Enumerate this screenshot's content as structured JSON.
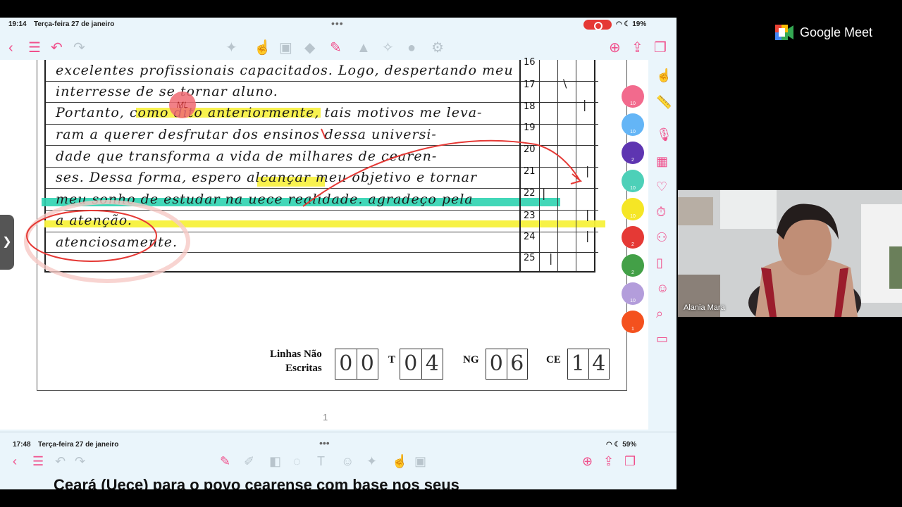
{
  "statusbar": {
    "time": "19:14",
    "date": "Terça-feira 27 de janeiro",
    "battery": "19%"
  },
  "statusbar2": {
    "time": "17:48",
    "date": "Terça-feira 27 de janeiro",
    "battery": "59%"
  },
  "handwriting": [
    "excelentes profissionais capacitados. Logo, despertando meu",
    "interresse de se tornar aluno.",
    "Portanto, como dito anteriormente, tais motivos me leva-",
    "ram a querer desfrutar dos ensinos dessa universi-",
    "dade que transforma a vida de milhares de cearen-",
    "ses. Dessa forma, espero alcançar meu objetivo e tornar",
    "meu sonho de estudar na uece realidade. agradeço pela",
    "a atenção.",
    "atenciosamente."
  ],
  "line_numbers": [
    "16",
    "17",
    "18",
    "19",
    "20",
    "21",
    "22",
    "23",
    "24",
    "25"
  ],
  "correction_mark": "ML",
  "score_labels": {
    "linhas1": "Linhas Não",
    "linhas2": "Escritas",
    "t": "T",
    "ng": "NG",
    "ce": "CE"
  },
  "score_values": {
    "linhas": [
      "0",
      "0"
    ],
    "t": [
      "0",
      "4"
    ],
    "ng": [
      "0",
      "6"
    ],
    "ce": [
      "1",
      "4"
    ]
  },
  "page_number": "1",
  "bottom_text": "Ceará (Uece) para o povo cearense com base nos seus",
  "pens": [
    {
      "color": "#f26a8d",
      "n": "10"
    },
    {
      "color": "#64b5f6",
      "n": "10"
    },
    {
      "color": "#5e35b1",
      "n": "2"
    },
    {
      "color": "#4dd0b8",
      "n": "10"
    },
    {
      "color": "#f5e625",
      "n": "10"
    },
    {
      "color": "#e53935",
      "n": "2"
    },
    {
      "color": "#43a047",
      "n": "2"
    },
    {
      "color": "#b39ddb",
      "n": "10"
    },
    {
      "color": "#f4511e",
      "n": "1"
    }
  ],
  "meet": {
    "title": "Google Meet",
    "participant": "Alania Mara"
  }
}
